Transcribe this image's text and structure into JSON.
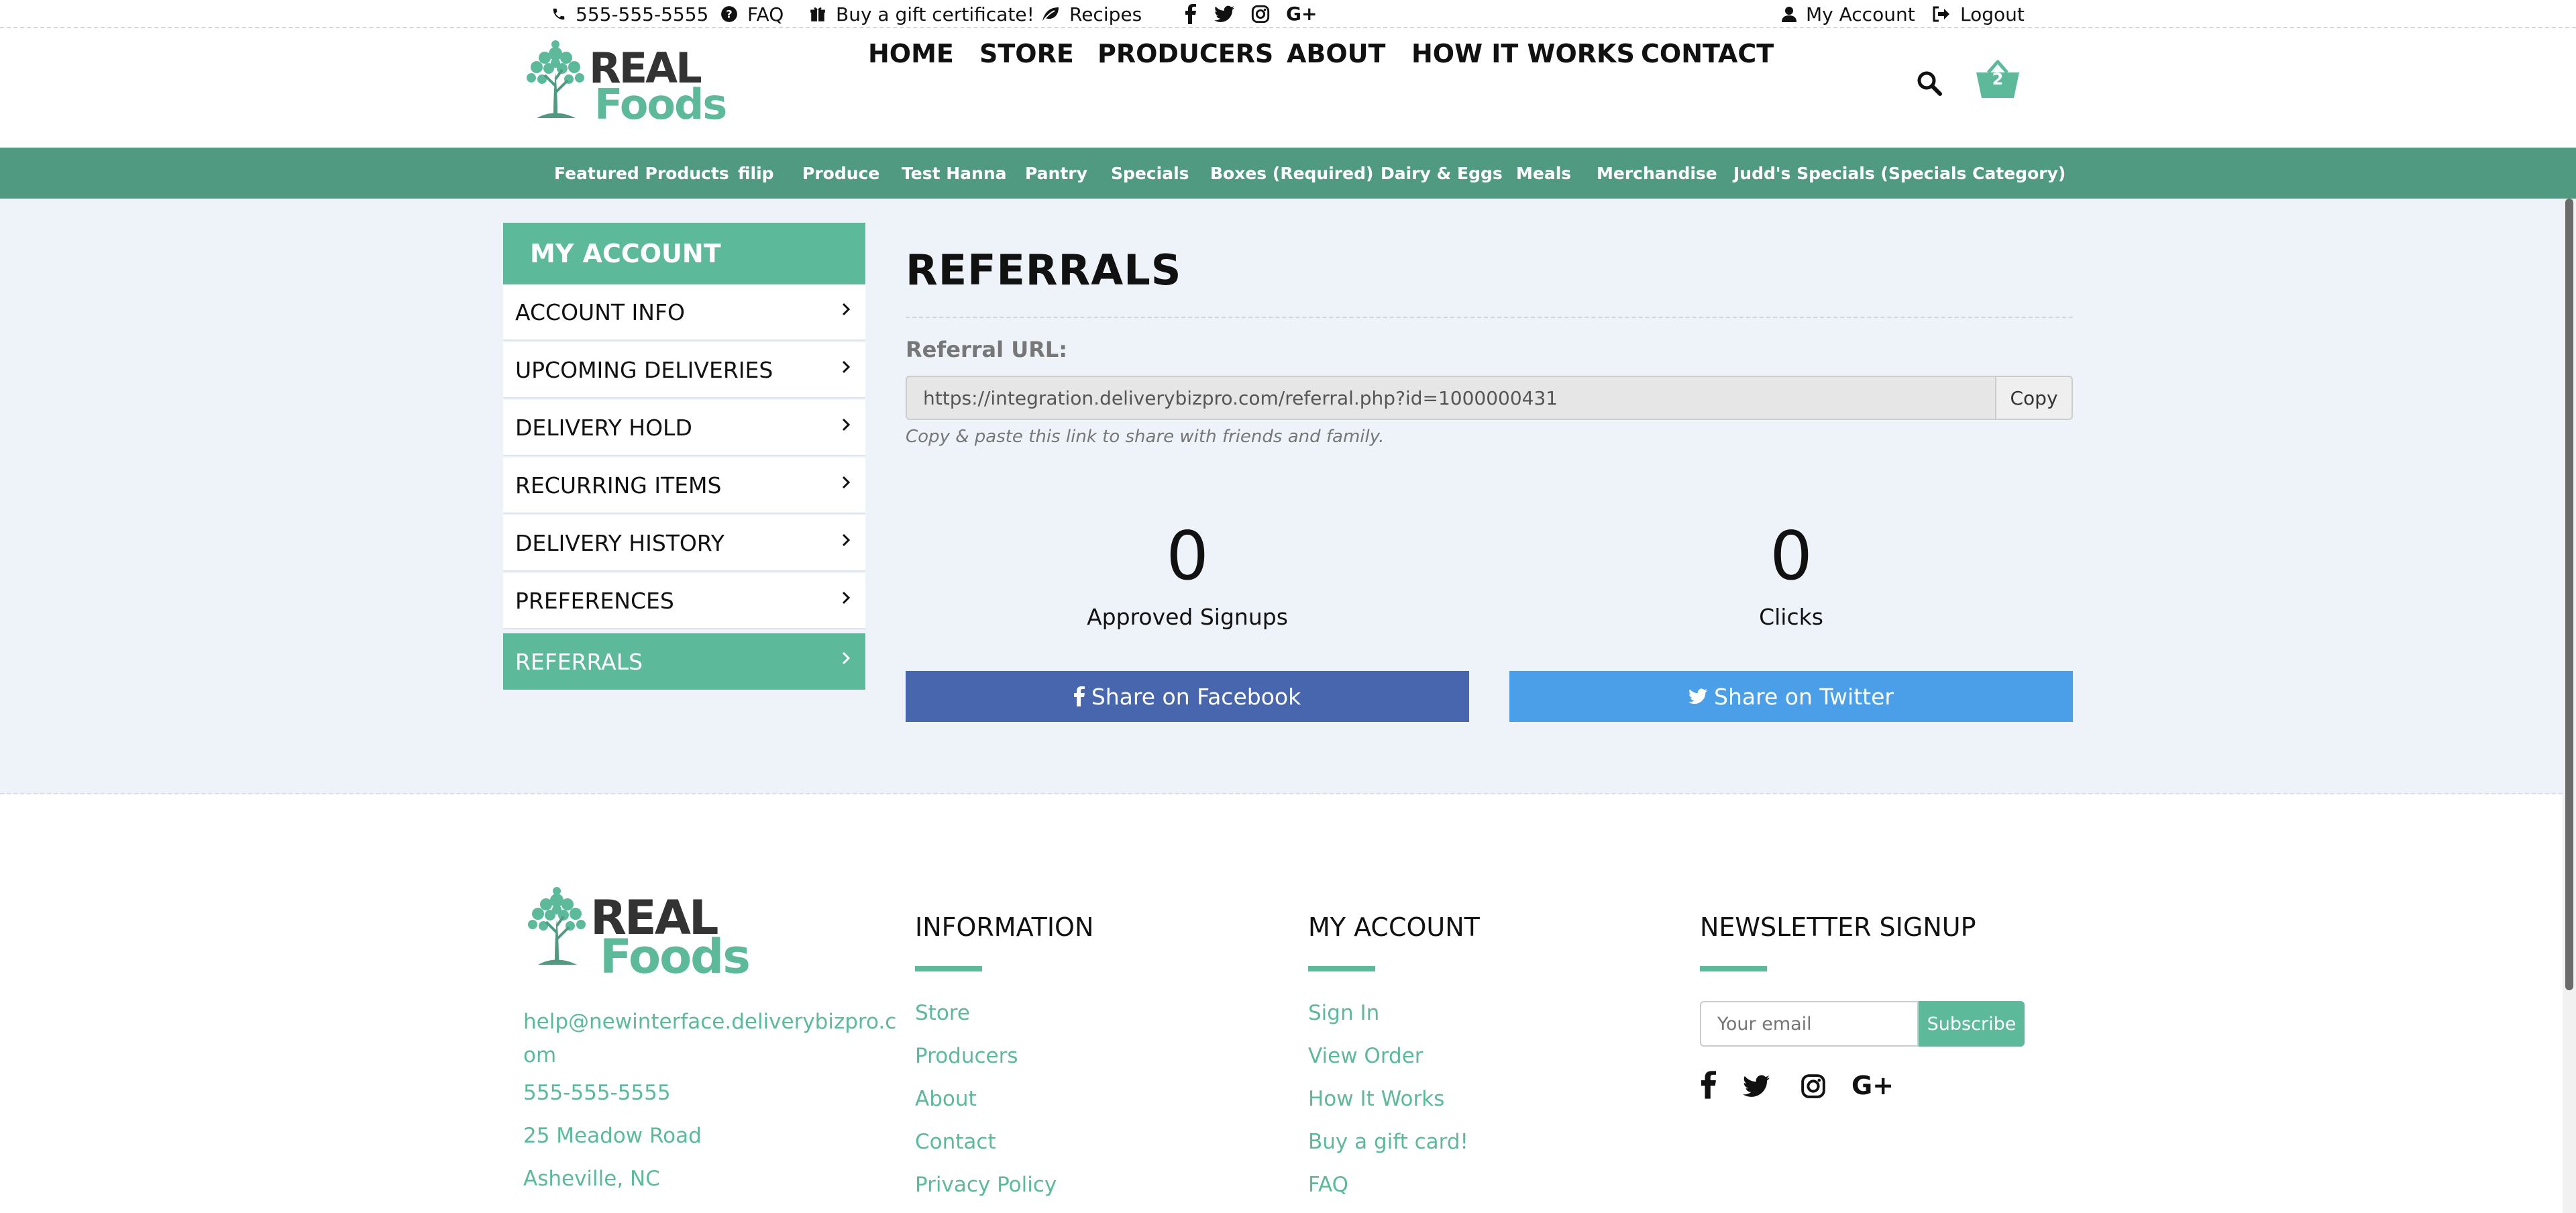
{
  "topbar": {
    "phone": "555-555-5555",
    "faq": "FAQ",
    "gift": "Buy a gift certificate!",
    "recipes": "Recipes",
    "my_account": "My Account",
    "logout": "Logout"
  },
  "logo": {
    "line1": "REAL",
    "line2": "Foods"
  },
  "nav": [
    "HOME",
    "STORE",
    "PRODUCERS",
    "ABOUT",
    "HOW IT WORKS",
    "CONTACT"
  ],
  "cart": {
    "count": "2"
  },
  "categories": [
    "Featured Products",
    "filip",
    "Produce",
    "Test Hanna",
    "Pantry",
    "Specials",
    "Boxes (Required)",
    "Dairy & Eggs",
    "Meals",
    "Merchandise",
    "Judd's Specials (Specials Category)"
  ],
  "sidebar": {
    "title": "MY ACCOUNT",
    "items": [
      "ACCOUNT INFO",
      "UPCOMING DELIVERIES",
      "DELIVERY HOLD",
      "RECURRING ITEMS",
      "DELIVERY HISTORY",
      "PREFERENCES",
      "REFERRALS"
    ]
  },
  "referrals": {
    "title": "REFERRALS",
    "url_label": "Referral URL:",
    "url": "https://integration.deliverybizpro.com/referral.php?id=1000000431",
    "copy": "Copy",
    "help": "Copy & paste this link to share with friends and family.",
    "approved_count": "0",
    "approved_label": "Approved Signups",
    "clicks_count": "0",
    "clicks_label": "Clicks",
    "share_fb": "Share on Facebook",
    "share_tw": "Share on Twitter"
  },
  "footer": {
    "email_line1": "help@newinterface.deliverybizpro.c",
    "email_line2": "om",
    "phone": "555-555-5555",
    "address": "25 Meadow Road",
    "city": "Asheville, NC",
    "information_title": "INFORMATION",
    "information_links": [
      "Store",
      "Producers",
      "About",
      "Contact",
      "Privacy Policy"
    ],
    "account_title": "MY ACCOUNT",
    "account_links": [
      "Sign In",
      "View Order",
      "How It Works",
      "Buy a gift card!",
      "FAQ"
    ],
    "newsletter_title": "NEWSLETTER SIGNUP",
    "email_placeholder": "Your email",
    "subscribe": "Subscribe"
  },
  "colors": {
    "accent": "#5cb99a",
    "category_bar": "#4f9a80",
    "facebook": "#4866ad",
    "twitter": "#4b9fe8",
    "main_bg": "#eef2f9"
  }
}
